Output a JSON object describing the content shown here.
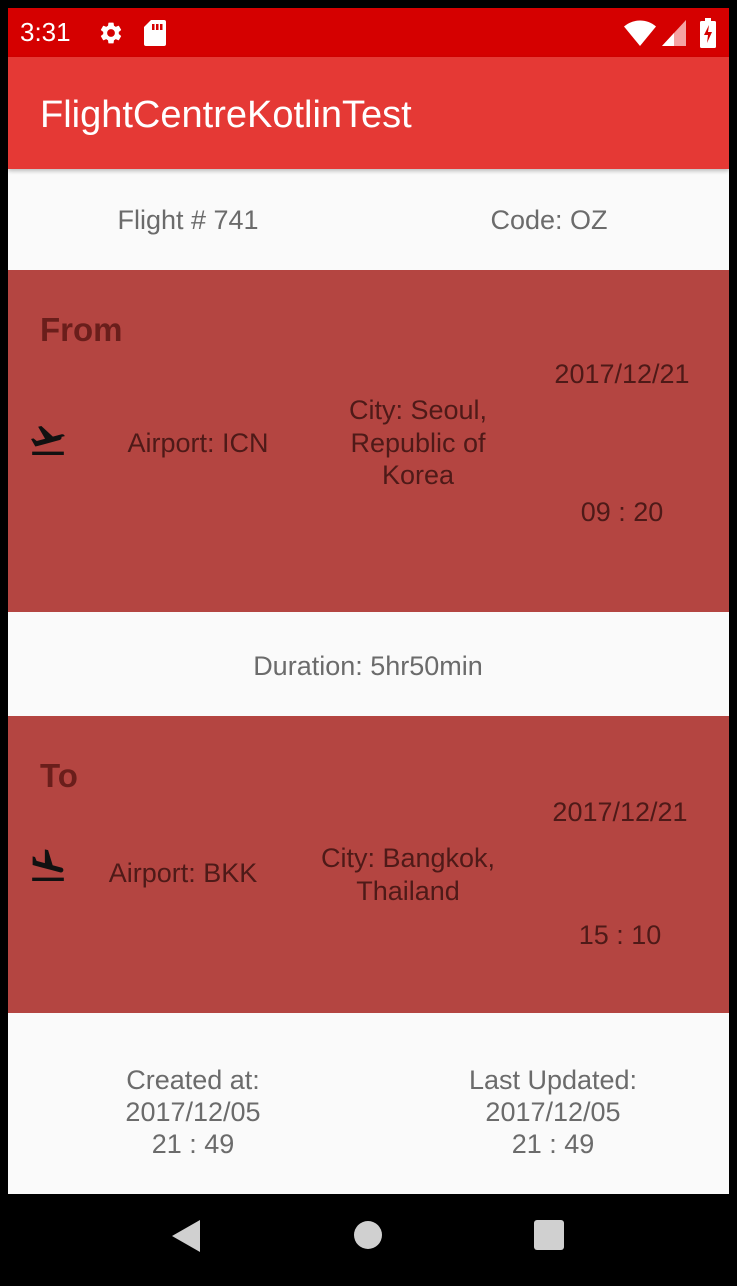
{
  "status_bar": {
    "time": "3:31",
    "icons": [
      "settings-icon",
      "sd-card-icon",
      "wifi-icon",
      "signal-icon",
      "battery-charging-icon"
    ],
    "color": "#d50000"
  },
  "app_bar": {
    "title": "FlightCentreKotlinTest",
    "color": "#e53935"
  },
  "flight": {
    "number_label": "Flight # 741",
    "code_label": "Code: OZ"
  },
  "from": {
    "title": "From",
    "airport": "Airport: ICN",
    "city_lines": [
      "City: Seoul,",
      "Republic of",
      "Korea"
    ],
    "date": "2017/12/21",
    "time": "09 : 20",
    "icon": "flight-takeoff-icon"
  },
  "duration": "Duration: 5hr50min",
  "to": {
    "title": "To",
    "airport": "Airport: BKK",
    "city_lines": [
      "City: Bangkok,",
      "Thailand"
    ],
    "date": "2017/12/21",
    "time": "15 : 10",
    "icon": "flight-land-icon"
  },
  "created": {
    "label": "Created at:",
    "date": "2017/12/05",
    "time": "21 : 49"
  },
  "updated": {
    "label": "Last Updated:",
    "date": "2017/12/05",
    "time": "21 : 49"
  },
  "panel_color": "#b44541",
  "nav_bar": {
    "icons": [
      "back-icon",
      "home-icon",
      "recents-icon"
    ]
  }
}
